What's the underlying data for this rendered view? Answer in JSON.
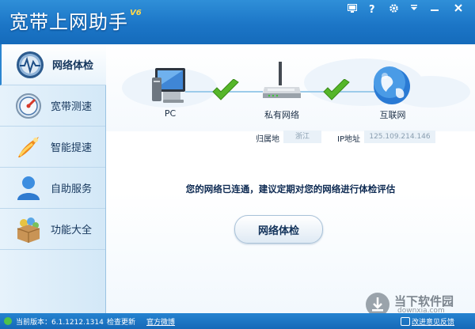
{
  "app": {
    "title": "宽带上网助手",
    "version": "V6"
  },
  "window_buttons": [
    {
      "name": "skin-button",
      "icon": "skin-icon"
    },
    {
      "name": "help-button",
      "icon": "help-icon"
    },
    {
      "name": "settings-button",
      "icon": "gear-icon"
    },
    {
      "name": "menu-button",
      "icon": "dropdown-icon"
    },
    {
      "name": "minimize-button",
      "icon": "minimize-icon"
    },
    {
      "name": "close-button",
      "icon": "close-icon"
    }
  ],
  "sidebar": {
    "items": [
      {
        "label": "网络体检",
        "icon": "network-check-icon",
        "active": true
      },
      {
        "label": "宽带测速",
        "icon": "speedometer-icon",
        "active": false
      },
      {
        "label": "智能提速",
        "icon": "rocket-icon",
        "active": false
      },
      {
        "label": "自助服务",
        "icon": "user-icon",
        "active": false
      },
      {
        "label": "功能大全",
        "icon": "toolbox-icon",
        "active": false
      }
    ]
  },
  "network": {
    "pc_label": "PC",
    "router_label": "私有网络",
    "internet_label": "互联网",
    "location_key": "归属地",
    "location_value": "浙江",
    "ip_key": "IP地址",
    "ip_value": "125.109.214.146"
  },
  "main": {
    "status_message": "您的网络已连通，建议定期对您的网络进行体检评估",
    "check_button_label": "网络体检"
  },
  "statusbar": {
    "version_text": "当前版本：6.1.1212.1314",
    "update_link": "检查更新",
    "weibo_link": "官方微博",
    "feedback_link": "改进意见反馈"
  },
  "watermark": {
    "text": "当下软件园",
    "sub": "downxia.com"
  },
  "colors": {
    "titlebar": "#1c76c7",
    "accent": "#2b85d0",
    "check_green": "#56b629"
  }
}
